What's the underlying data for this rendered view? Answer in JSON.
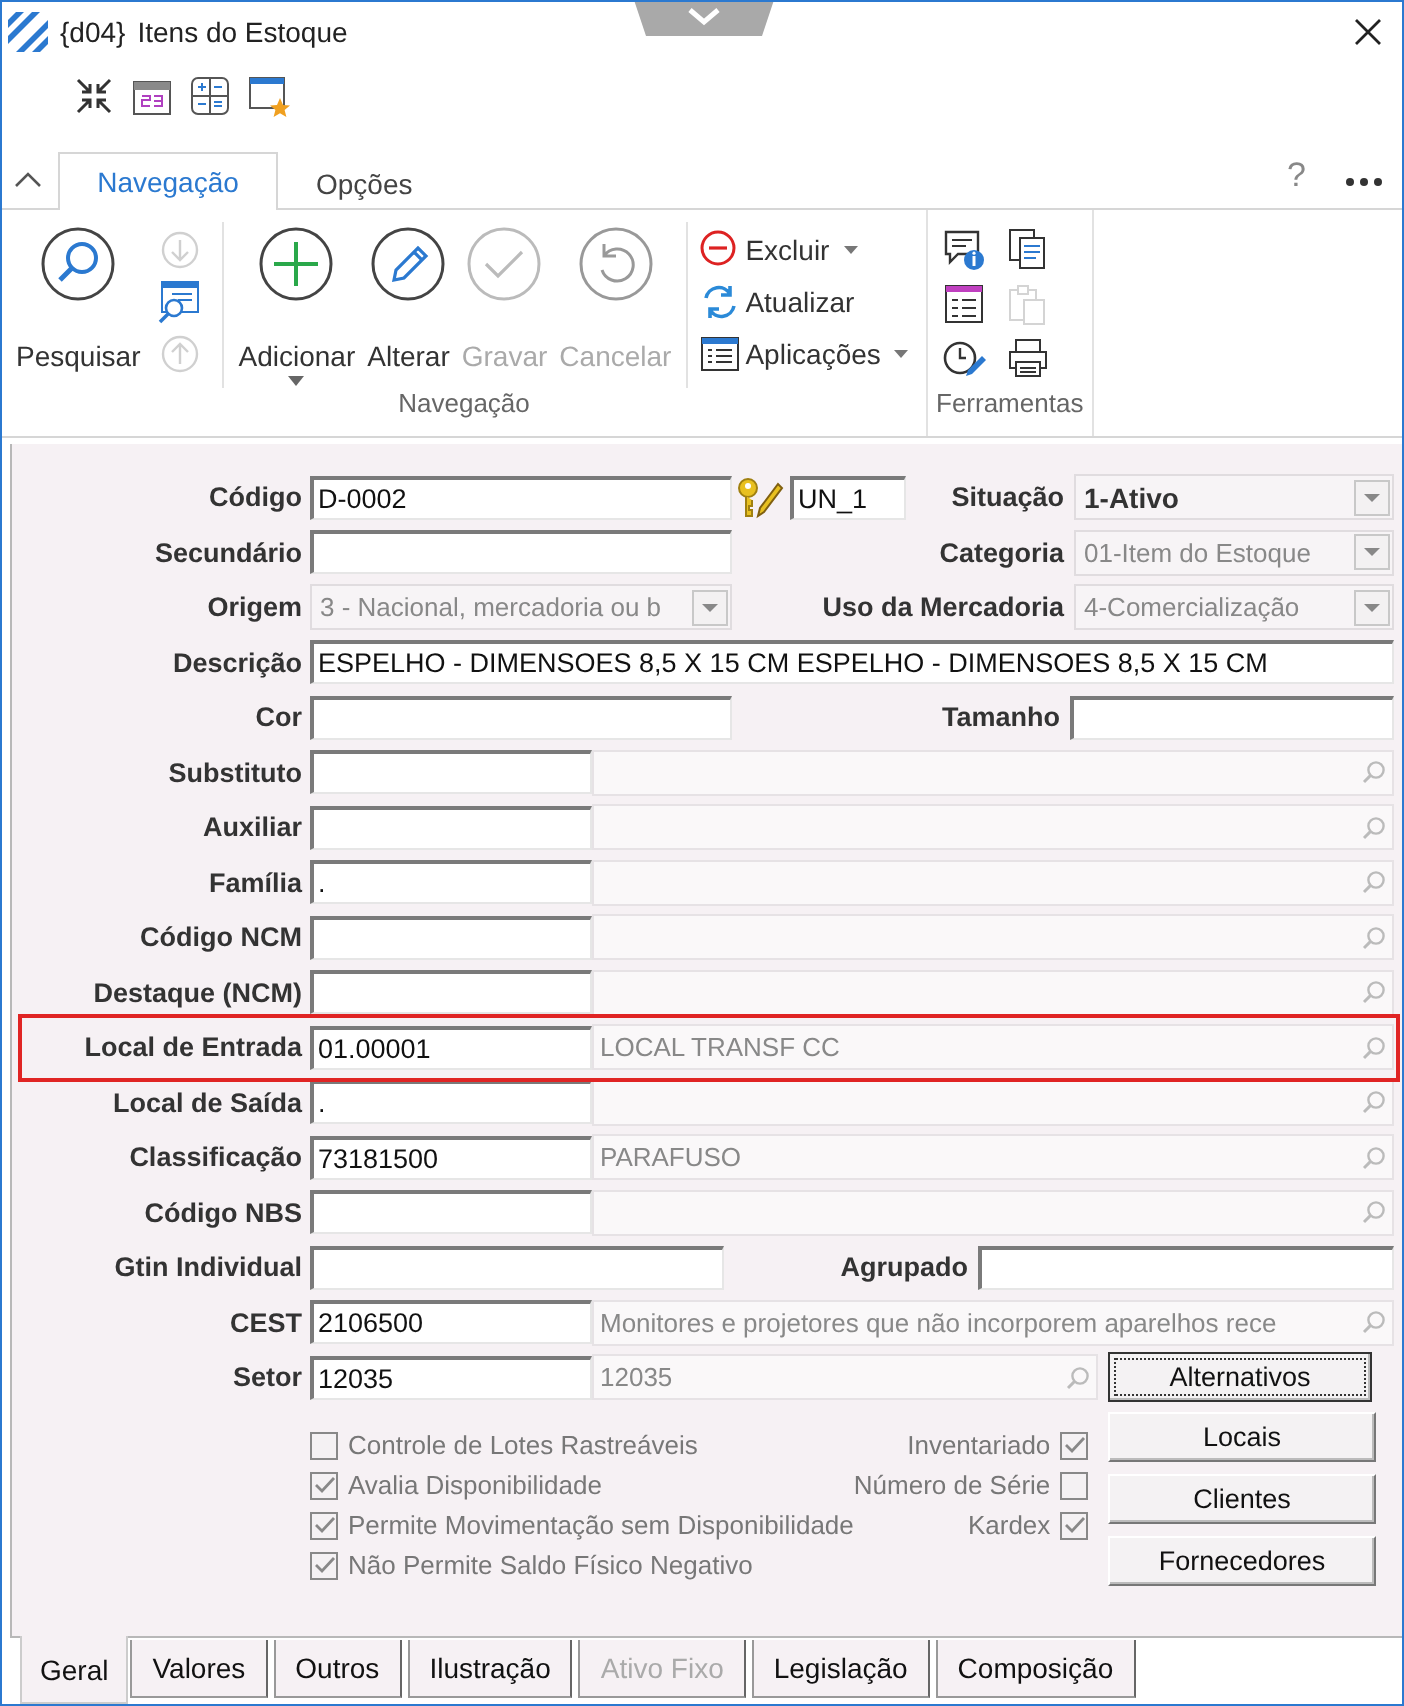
{
  "window": {
    "code": "{d04}",
    "title": "Itens do Estoque"
  },
  "ribbon": {
    "tabs": [
      {
        "label": "Navegação",
        "selected": true
      },
      {
        "label": "Opções",
        "selected": false
      }
    ],
    "help": "?",
    "navigation": {
      "label": "Navegação",
      "search": {
        "label": "Pesquisar",
        "disabled": false
      },
      "nav_icons": [
        {
          "disabled": true
        },
        {
          "disabled": false
        },
        {
          "disabled": true
        }
      ],
      "actions": [
        {
          "label": "Adicionar",
          "disabled": false,
          "dropdown": true
        },
        {
          "label": "Alterar",
          "disabled": false,
          "dropdown": false
        },
        {
          "label": "Gravar",
          "disabled": true,
          "dropdown": false
        },
        {
          "label": "Cancelar",
          "disabled": true,
          "dropdown": false
        }
      ],
      "commands": [
        {
          "label": "Excluir",
          "dropdown": true
        },
        {
          "label": "Atualizar",
          "dropdown": false
        },
        {
          "label": "Aplicações",
          "dropdown": true
        }
      ]
    },
    "tools": {
      "label": "Ferramentas",
      "buttons": [
        {
          "disabled": false
        },
        {
          "disabled": false
        },
        {
          "disabled": false
        },
        {
          "disabled": false
        },
        {
          "disabled": true
        },
        {
          "disabled": false
        }
      ]
    }
  },
  "form": {
    "rows": [
      {
        "kind": "code",
        "label": "Código",
        "value": "D-0002",
        "unit": "UN_1",
        "right_label": "Situação",
        "right_value": "1-Ativo",
        "right_disabled": false
      },
      {
        "kind": "textcombo",
        "label": "Secundário",
        "right_label": "Categoria",
        "right_value": "01-Item do Estoque",
        "right_disabled": true
      },
      {
        "kind": "combocombo",
        "label": "Origem",
        "value": "3 - Nacional, mercadoria ou b",
        "right_label": "Uso da Mercadoria",
        "right_value": "4-Comercialização",
        "right_disabled": true
      },
      {
        "kind": "wide",
        "label": "Descrição",
        "value": "ESPELHO - DIMENSOES 8,5 X 15 CM ESPELHO - DIMENSOES 8,5 X 15 CM"
      },
      {
        "kind": "double",
        "label": "Cor",
        "right_label": "Tamanho"
      },
      {
        "kind": "lookup",
        "label": "Substituto",
        "highlighted": false
      },
      {
        "kind": "lookup",
        "label": "Auxiliar",
        "highlighted": false
      },
      {
        "kind": "lookup",
        "label": "Família",
        "code": ".",
        "highlighted": false
      },
      {
        "kind": "lookup",
        "label": "Código NCM",
        "highlighted": false
      },
      {
        "kind": "lookup",
        "label": "Destaque (NCM)",
        "highlighted": false
      },
      {
        "kind": "lookup",
        "label": "Local de Entrada",
        "code": "01.00001",
        "description": "LOCAL TRANSF CC",
        "highlighted": true
      },
      {
        "kind": "lookup",
        "label": "Local de Saída",
        "code": ".",
        "highlighted": false
      },
      {
        "kind": "lookup",
        "label": "Classificação",
        "code": "73181500",
        "description": "PARAFUSO",
        "highlighted": false
      },
      {
        "kind": "lookup",
        "label": "Código NBS",
        "highlighted": false
      },
      {
        "kind": "split",
        "label": "Gtin Individual",
        "right_label": "Agrupado"
      },
      {
        "kind": "lookup",
        "label": "CEST",
        "code": "2106500",
        "description": "Monitores e projetores que não incorporem aparelhos rece",
        "highlighted": false
      },
      {
        "kind": "lookupbutton",
        "label": "Setor",
        "code": "12035",
        "description": "12035",
        "button": "Alternativos",
        "highlighted": false
      }
    ],
    "options_left": [
      {
        "label": "Controle de Lotes Rastreáveis",
        "checked": false
      },
      {
        "label": "Avalia Disponibilidade",
        "checked": true
      },
      {
        "label": "Permite Movimentação sem Disponibilidade",
        "checked": true
      },
      {
        "label": "Não Permite Saldo Físico Negativo",
        "checked": true
      }
    ],
    "options_right": [
      {
        "label": "Inventariado",
        "checked": true
      },
      {
        "label": "Número de Série",
        "checked": false
      },
      {
        "label": "Kardex",
        "checked": true
      }
    ],
    "side_buttons": [
      "Locais",
      "Clientes",
      "Fornecedores"
    ]
  },
  "bottom_tabs": [
    {
      "label": "Geral",
      "selected": true,
      "disabled": false
    },
    {
      "label": "Valores",
      "selected": false,
      "disabled": false
    },
    {
      "label": "Outros",
      "selected": false,
      "disabled": false
    },
    {
      "label": "Ilustração",
      "selected": false,
      "disabled": false
    },
    {
      "label": "Ativo Fixo",
      "selected": false,
      "disabled": true
    },
    {
      "label": "Legislação",
      "selected": false,
      "disabled": false
    },
    {
      "label": "Composição",
      "selected": false,
      "disabled": false
    }
  ]
}
